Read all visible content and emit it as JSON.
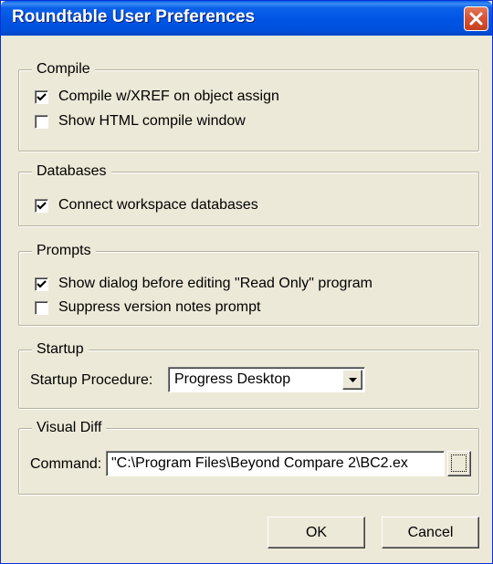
{
  "window": {
    "title": "Roundtable User Preferences"
  },
  "groups": {
    "compile": {
      "title": "Compile",
      "options": [
        {
          "label": "Compile w/XREF on object assign",
          "checked": true
        },
        {
          "label": "Show HTML compile window",
          "checked": false
        }
      ]
    },
    "databases": {
      "title": "Databases",
      "options": [
        {
          "label": "Connect workspace databases",
          "checked": true
        }
      ]
    },
    "prompts": {
      "title": "Prompts",
      "options": [
        {
          "label": "Show dialog before editing \"Read Only\" program",
          "checked": true
        },
        {
          "label": "Suppress version notes prompt",
          "checked": false
        }
      ]
    },
    "startup": {
      "title": "Startup",
      "procedure_label": "Startup Procedure:",
      "procedure_value": "Progress Desktop"
    },
    "visual_diff": {
      "title": "Visual Diff",
      "command_label": "Command:",
      "command_value": "\"C:\\Program Files\\Beyond Compare 2\\BC2.ex"
    }
  },
  "buttons": {
    "ok": "OK",
    "cancel": "Cancel"
  },
  "icons": {
    "close": "close-icon",
    "checkmark": "checkmark-icon",
    "dropdown": "chevron-down-icon"
  },
  "colors": {
    "title_bar": "#0054E3",
    "close_button": "#D9573A",
    "dialog_background": "#ECE9D8"
  }
}
